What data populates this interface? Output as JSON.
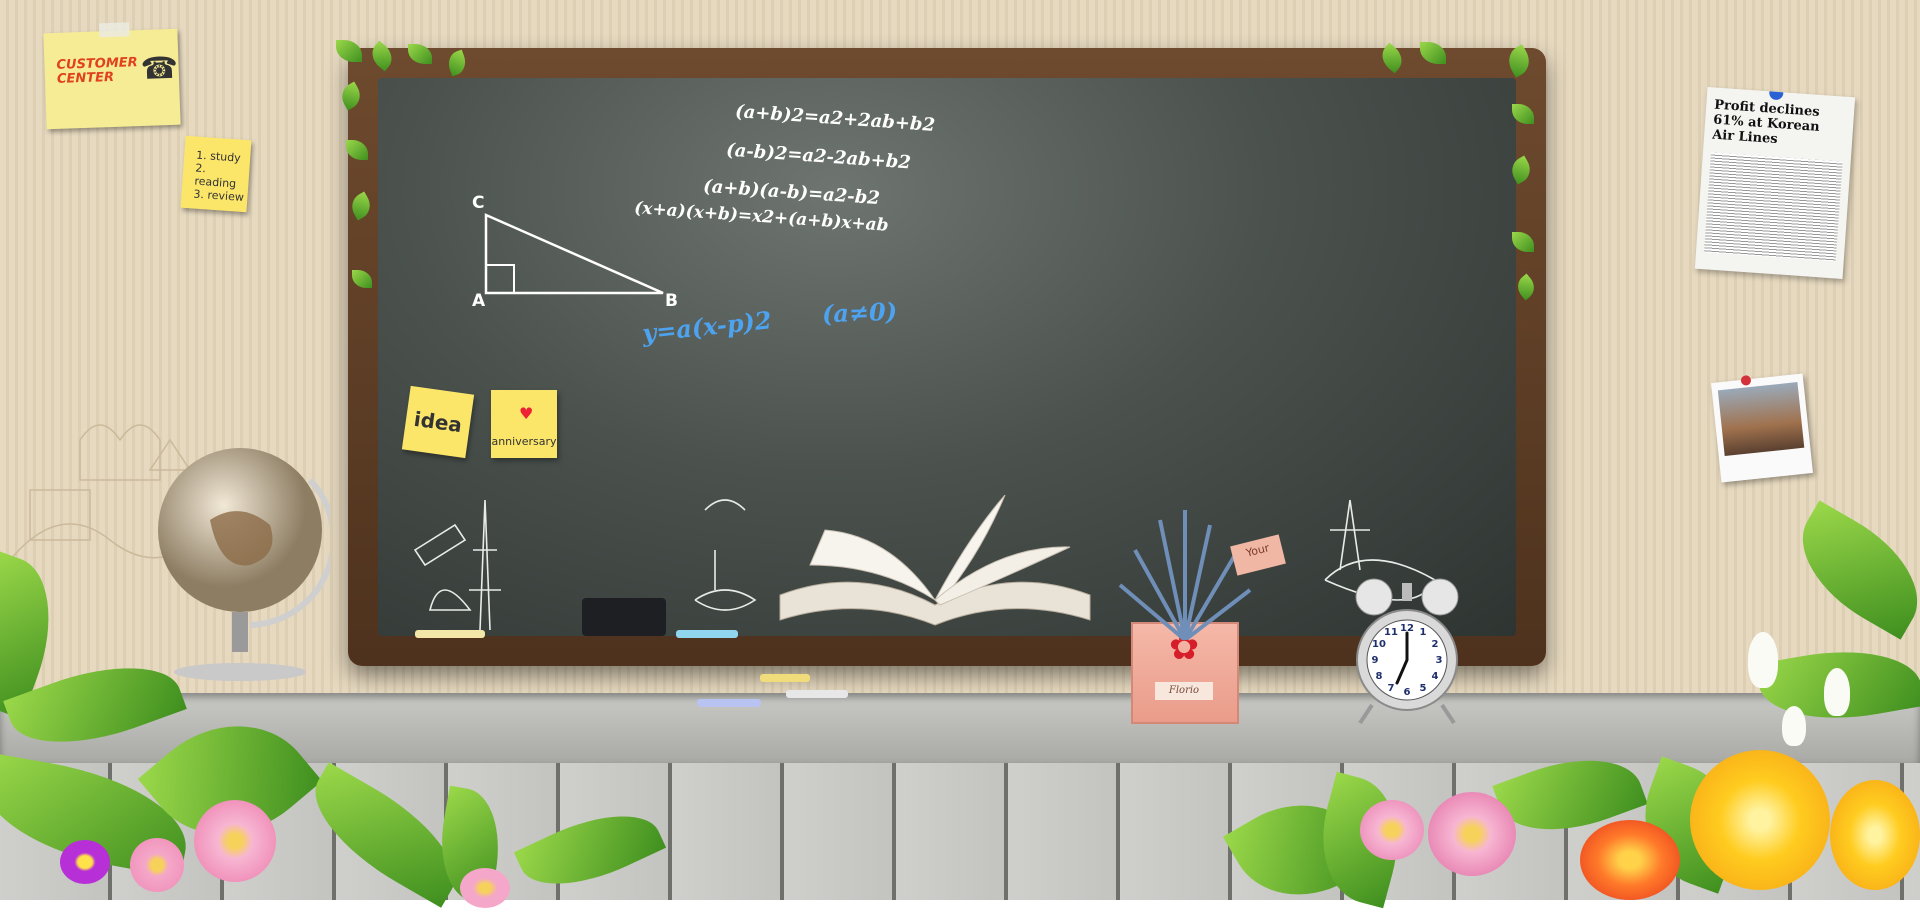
{
  "notes": {
    "customer_center": "CUSTOMER\nCENTER",
    "todo": [
      "1. study",
      "2. reading",
      "3. review"
    ],
    "idea": "idea",
    "anniversary": "anniversary",
    "tag": "Your"
  },
  "chalkboard": {
    "formulas": [
      "(a+b)2=a2+2ab+b2",
      "(a-b)2=a2-2ab+b2",
      "(a+b)(a-b)=a2-b2",
      "(x+a)(x+b)=x2+(a+b)x+ab"
    ],
    "parabola": "y=a(x-p)2",
    "condition": "(a≠0)",
    "triangle_labels": [
      "C",
      "A",
      "B"
    ]
  },
  "newspaper": {
    "headline": "Profit declines 61% at Korean Air Lines"
  },
  "box_label": "Florio",
  "clock": {
    "numbers": [
      "12",
      "1",
      "2",
      "3",
      "4",
      "5",
      "6",
      "7",
      "8",
      "9",
      "10",
      "11"
    ]
  },
  "colors": {
    "board": "#4b524e",
    "frame": "#5e3d24",
    "sticky": "#fbe66a",
    "chalk_blue": "#4da3f0"
  }
}
